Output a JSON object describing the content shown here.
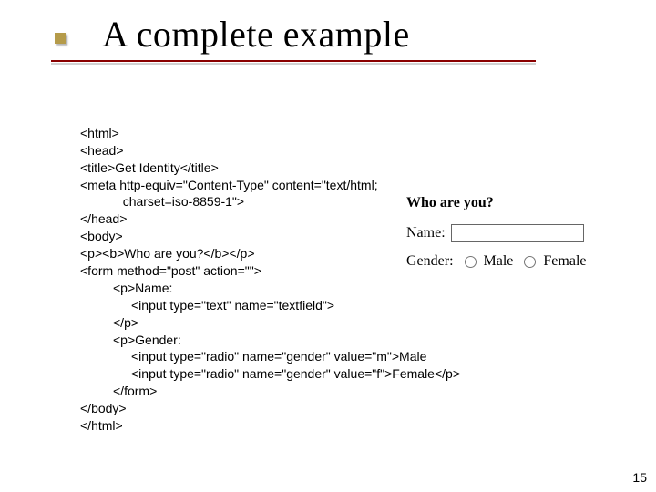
{
  "slide": {
    "title": "A complete example",
    "page_number": "15"
  },
  "code": {
    "l1": "<html>",
    "l2": "<head>",
    "l3": "<title>Get Identity</title>",
    "l4": "<meta http-equiv=\"Content-Type\" content=\"text/html;",
    "l5": "charset=iso-8859-1\">",
    "l6": "</head>",
    "l7": "<body>",
    "l8": "<p><b>Who are you?</b></p>",
    "l9": "<form method=\"post\" action=\"\">",
    "l10": "<p>Name:",
    "l11": "<input type=\"text\" name=\"textfield\">",
    "l12": "</p>",
    "l13": "<p>Gender:",
    "l14": "<input type=\"radio\" name=\"gender\" value=\"m\">Male",
    "l15": "<input type=\"radio\" name=\"gender\" value=\"f\">Female</p>",
    "l16": "</form>",
    "l17": "</body>",
    "l18": "</html>"
  },
  "preview": {
    "heading": "Who are you?",
    "name_label": "Name:",
    "gender_label": "Gender:",
    "male": "Male",
    "female": "Female"
  }
}
